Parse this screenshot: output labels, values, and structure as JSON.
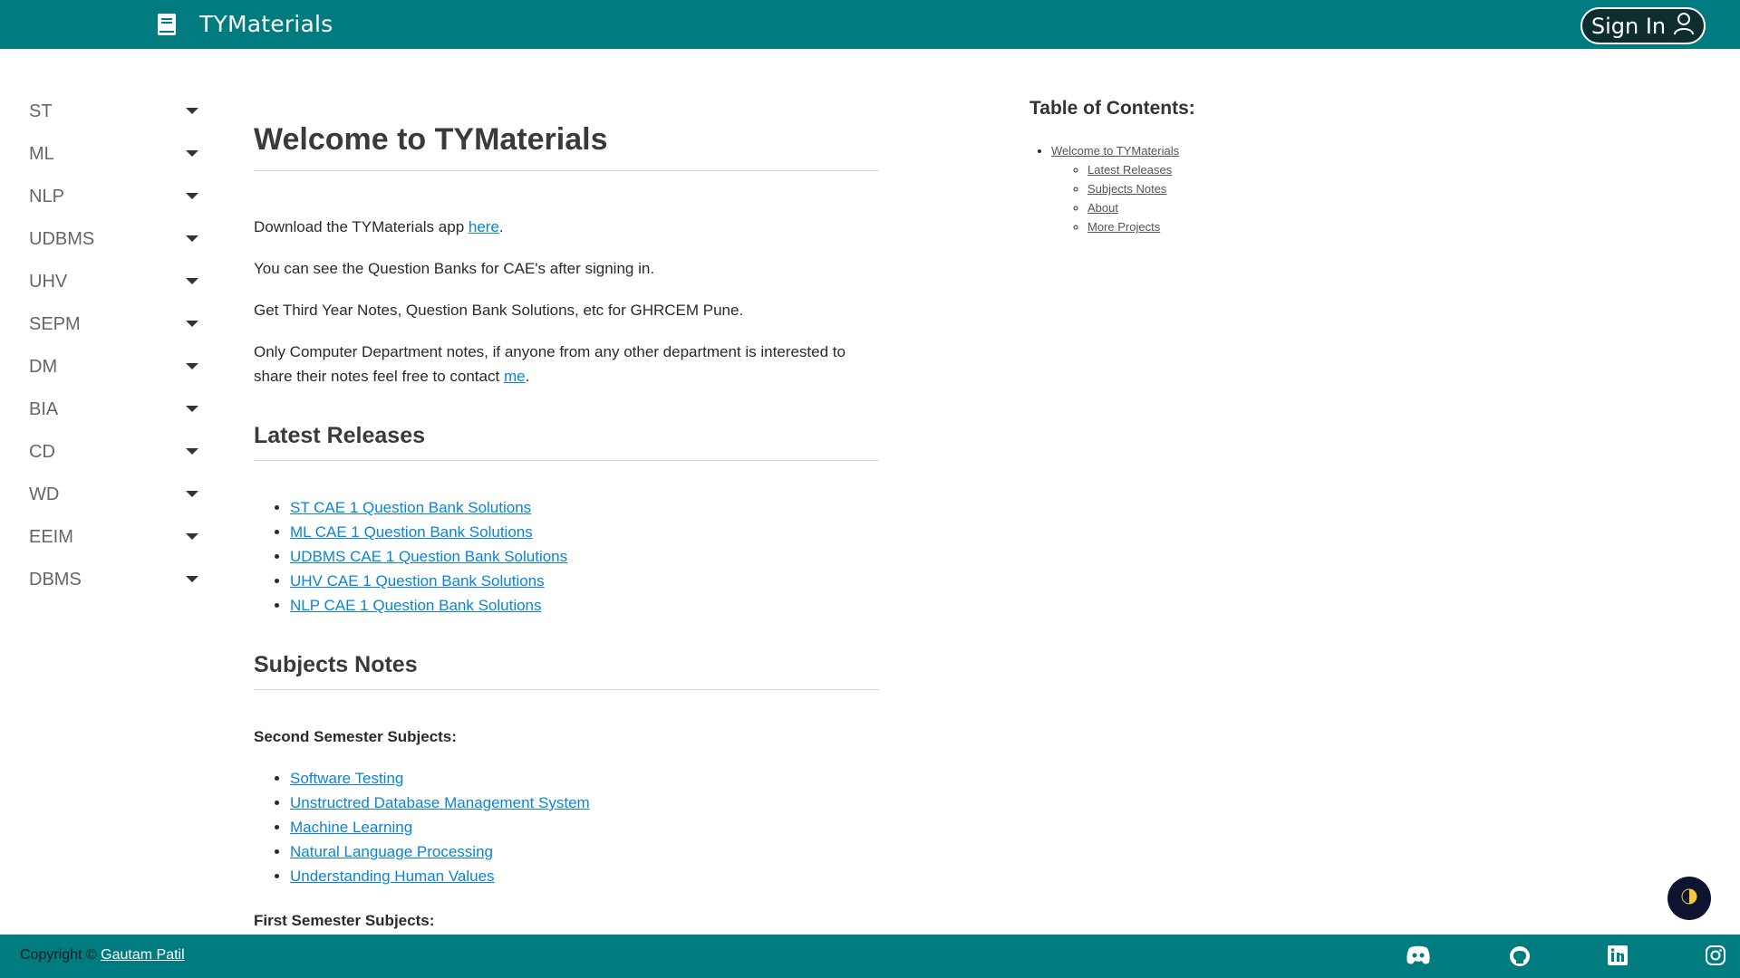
{
  "header": {
    "brand_title": "TYMaterials",
    "brand_icon": "book-icon",
    "signin_label": "Sign In",
    "signin_icon": "user-icon"
  },
  "sidebar": {
    "items": [
      {
        "label": "ST"
      },
      {
        "label": "ML"
      },
      {
        "label": "NLP"
      },
      {
        "label": "UDBMS"
      },
      {
        "label": "UHV"
      },
      {
        "label": "SEPM"
      },
      {
        "label": "DM"
      },
      {
        "label": "BIA"
      },
      {
        "label": "CD"
      },
      {
        "label": "WD"
      },
      {
        "label": "EEIM"
      },
      {
        "label": "DBMS"
      }
    ]
  },
  "main": {
    "title": "Welcome to TYMaterials",
    "p1_before": "Download the TYMaterials app ",
    "p1_link": "here",
    "p1_after": ".",
    "p2": "You can see the Question Banks for CAE's after signing in.",
    "p3": "Get Third Year Notes, Question Bank Solutions, etc for GHRCEM Pune.",
    "p4_before": "Only Computer Department notes, if anyone from any other department is interested to share their notes feel free to contact ",
    "p4_link": "me",
    "p4_after": ".",
    "latest_heading": "Latest Releases",
    "latest_items": [
      "ST CAE 1 Question Bank Solutions",
      "ML CAE 1 Question Bank Solutions",
      "UDBMS CAE 1 Question Bank Solutions",
      "UHV CAE 1 Question Bank Solutions",
      "NLP CAE 1 Question Bank Solutions"
    ],
    "subjects_heading": "Subjects Notes",
    "second_sem_label": "Second Semester Subjects:",
    "second_sem_items": [
      "Software Testing",
      "Unstructred Database Management System",
      "Machine Learning",
      "Natural Language Processing",
      "Understanding Human Values"
    ],
    "first_sem_label": "First Semester Subjects:"
  },
  "toc": {
    "title": "Table of Contents:",
    "top_item": "Welcome to TYMaterials",
    "sub_items": [
      "Latest Releases",
      "Subjects Notes",
      "About",
      "More Projects"
    ]
  },
  "theme_toggle_icon": "half-moon-icon",
  "footer": {
    "copyright_prefix": "Copyright © ",
    "author_link": "Gautam Patil",
    "social_icons": [
      "discord-icon",
      "github-icon",
      "linkedin-icon",
      "instagram-icon"
    ]
  },
  "colors": {
    "brand_teal": "#007b80",
    "link_blue": "#0a84d8",
    "theme_button_bg": "#0e1330"
  }
}
